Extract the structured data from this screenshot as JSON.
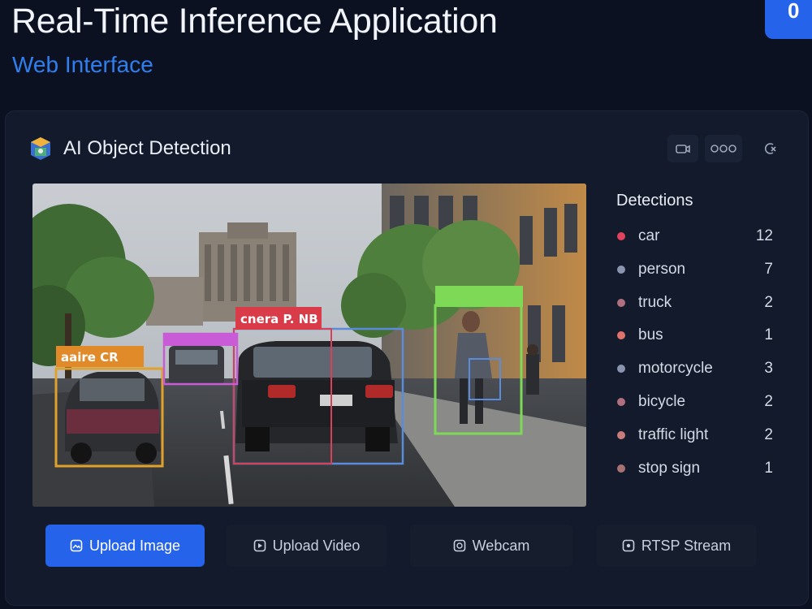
{
  "header": {
    "title": "Real-Time Inference Application",
    "subtitle": "Web Interface",
    "badge_text": "0"
  },
  "panel": {
    "title": "AI Object Detection",
    "header_icons": [
      "camera-icon",
      "options-icon",
      "close-icon"
    ],
    "colors": {
      "accent": "#2563eb",
      "panel_bg": "#121a2b",
      "page_bg": "#0b1120"
    }
  },
  "viewport": {
    "boxes": [
      {
        "label": "car",
        "color": "#e0a22a",
        "tag": "aaire CR"
      },
      {
        "label": "car",
        "color": "#d9405a",
        "tag": "cnera P. NB"
      },
      {
        "label": "person",
        "color": "#7ed957",
        "tag": ""
      },
      {
        "label": "car",
        "color": "#c95bd6",
        "tag": ""
      },
      {
        "label": "car",
        "color": "#5b8bdb",
        "tag": ""
      }
    ]
  },
  "detections": {
    "title": "Detections",
    "items": [
      {
        "label": "car",
        "count": "12",
        "color": "#e0435b"
      },
      {
        "label": "person",
        "count": "7",
        "color": "#8a94b0"
      },
      {
        "label": "truck",
        "count": "2",
        "color": "#b0707f"
      },
      {
        "label": "bus",
        "count": "1",
        "color": "#e0726b"
      },
      {
        "label": "motorcycle",
        "count": "3",
        "color": "#8a94b0"
      },
      {
        "label": "bicycle",
        "count": "2",
        "color": "#b0707f"
      },
      {
        "label": "traffic light",
        "count": "2",
        "color": "#c97c7c"
      },
      {
        "label": "stop sign",
        "count": "1",
        "color": "#a77272"
      }
    ]
  },
  "sources": {
    "upload_image": "Upload Image",
    "upload_video": "Upload Video",
    "webcam": "Webcam",
    "rtsp": "RTSP Stream"
  }
}
